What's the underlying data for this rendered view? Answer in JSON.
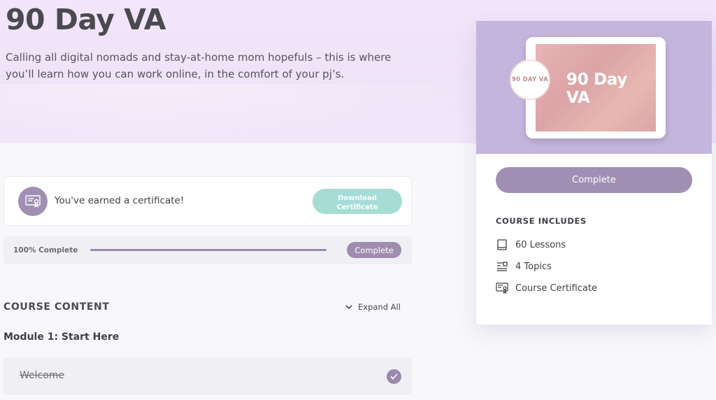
{
  "hero": {
    "title": "90 Day VA",
    "description": "Calling all digital nomads and stay-at-home mom hopefuls – this is where you’ll learn how you can work online, in the comfort of your pj’s."
  },
  "certificate": {
    "message": "You've earned a certificate!",
    "download_label_line1": "Download",
    "download_label_line2": "Certificate",
    "icon": "certificate-icon"
  },
  "progress": {
    "label": "100% Complete",
    "percent": 100,
    "button_label": "Complete"
  },
  "course_content": {
    "heading": "COURSE CONTENT",
    "expand_label": "Expand All",
    "module_title": "Module 1: Start Here",
    "lessons": [
      {
        "label": "Welcome",
        "completed": true
      }
    ]
  },
  "card": {
    "thumbnail_title": "90 Day VA",
    "thumbnail_logo": "90 DAY VA",
    "button_label": "Complete",
    "includes_heading": "COURSE INCLUDES",
    "includes": [
      {
        "label": "60 Lessons",
        "icon": "book-icon"
      },
      {
        "label": "4 Topics",
        "icon": "topics-icon"
      },
      {
        "label": "Course Certificate",
        "icon": "certificate-icon"
      }
    ]
  },
  "colors": {
    "accent": "#a08fb3",
    "download": "#a6dcd6",
    "hero_bg": "#f3e5fb",
    "thumb_bg": "#c4b5dd"
  }
}
